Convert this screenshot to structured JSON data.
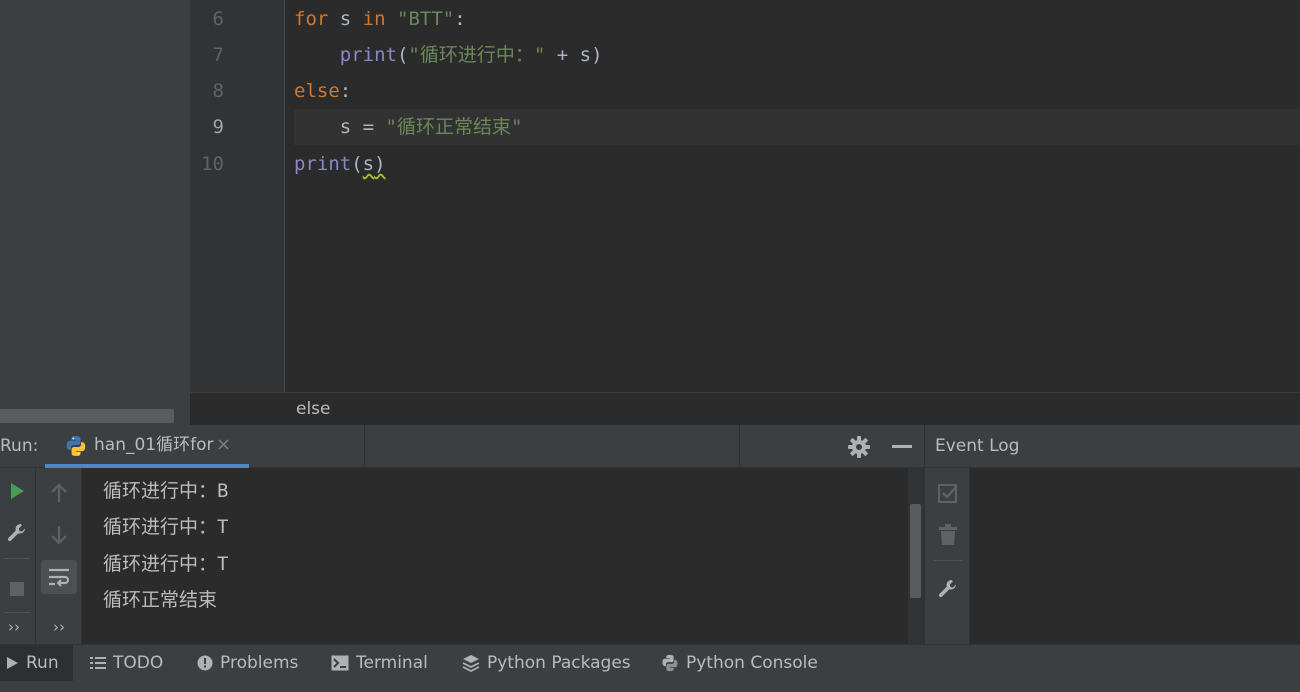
{
  "editor": {
    "lines": [
      {
        "number": "6",
        "tokens": [
          {
            "text": "for",
            "kind": "kw"
          },
          {
            "text": " s ",
            "kind": "plain"
          },
          {
            "text": "in",
            "kind": "kw"
          },
          {
            "text": " ",
            "kind": "plain"
          },
          {
            "text": "\"BTT\"",
            "kind": "str"
          },
          {
            "text": ":",
            "kind": "plain"
          }
        ]
      },
      {
        "number": "7",
        "tokens": [
          {
            "text": "    ",
            "kind": "plain"
          },
          {
            "text": "print",
            "kind": "fn"
          },
          {
            "text": "(",
            "kind": "plain"
          },
          {
            "text": "\"循环进行中：\"",
            "kind": "str"
          },
          {
            "text": " + s)",
            "kind": "plain"
          }
        ]
      },
      {
        "number": "8",
        "tokens": [
          {
            "text": "else",
            "kind": "kw"
          },
          {
            "text": ":",
            "kind": "plain"
          }
        ]
      },
      {
        "number": "9",
        "current": true,
        "tokens": [
          {
            "text": "    s = ",
            "kind": "plain"
          },
          {
            "text": "\"循环正常结束\"",
            "kind": "str"
          }
        ]
      },
      {
        "number": "10",
        "tokens": [
          {
            "text": "print",
            "kind": "fn"
          },
          {
            "text": "(",
            "kind": "plain"
          },
          {
            "text": "s",
            "kind": "warn"
          },
          {
            "text": ")",
            "kind": "warn"
          }
        ]
      }
    ],
    "breadcrumb": "else"
  },
  "run_panel": {
    "title": "Run:",
    "tab_label": "han_01循环for",
    "tab_close": "×",
    "console_output": [
      "循环进行中：B",
      "循环进行中：T",
      "循环进行中：T",
      "循环正常结束"
    ],
    "more_left": "››",
    "more_right": "››"
  },
  "event_log": {
    "title": "Event Log"
  },
  "bottom_bar": {
    "tabs": [
      {
        "label": "Run",
        "icon": "play-icon",
        "active": true
      },
      {
        "label": "TODO",
        "icon": "list-icon"
      },
      {
        "label": "Problems",
        "icon": "problems-icon"
      },
      {
        "label": "Terminal",
        "icon": "terminal-icon"
      },
      {
        "label": "Python Packages",
        "icon": "layers-icon"
      },
      {
        "label": "Python Console",
        "icon": "python-icon"
      }
    ]
  },
  "colors": {
    "keyword": "#cc7832",
    "string": "#6a8759",
    "builtin": "#8888c6",
    "accent": "#4a88c7",
    "run_green": "#499c54"
  }
}
